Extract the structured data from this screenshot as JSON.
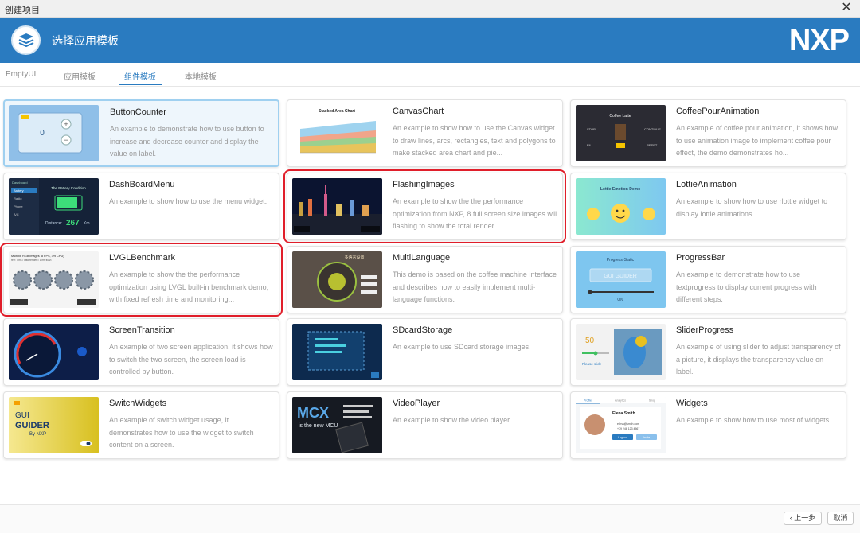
{
  "window": {
    "title": "创建项目",
    "close_glyph": "✕"
  },
  "header": {
    "title": "选择应用模板",
    "brand": "NXP"
  },
  "tabs": [
    {
      "label": "EmptyUI"
    },
    {
      "label": "应用模板"
    },
    {
      "label": "组件模板"
    },
    {
      "label": "本地模板"
    }
  ],
  "active_tab": "组件模板",
  "cards": [
    {
      "name": "ButtonCounter",
      "desc": "An example to demonstrate how to use button to increase and decrease counter and display the value on label.",
      "selected": true
    },
    {
      "name": "CanvasChart",
      "desc": "An example to show how to use the Canvas widget to draw lines, arcs, rectangles, text and polygons to make stacked area chart and pie..."
    },
    {
      "name": "CoffeePourAnimation",
      "desc": "An example of coffee pour animation, it shows how to use animation image to implement coffee pour effect, the demo demonstrates ho..."
    },
    {
      "name": "DashBoardMenu",
      "desc": "An example to show how to use the menu widget."
    },
    {
      "name": "FlashingImages",
      "desc": "An example to show the the performance optimization from NXP, 8 full screen size images will flashing to show the total render...",
      "highlighted": true
    },
    {
      "name": "LottieAnimation",
      "desc": "An example to show how to use rlottie widget to display lottie animations."
    },
    {
      "name": "LVGLBenchmark",
      "desc": "An example to show the the performance optimization using LVGL built-in benchmark demo, with fixed refresh time and monitoring...",
      "highlighted": true
    },
    {
      "name": "MultiLanguage",
      "desc": "This demo is based on the coffee machine interface and describes how to easily implement multi-language functions."
    },
    {
      "name": "ProgressBar",
      "desc": "An example to demonstrate how to use textprogress to display current progress with different steps."
    },
    {
      "name": "ScreenTransition",
      "desc": "An example of two screen application, it shows how to switch the two screen, the screen load is controlled by button."
    },
    {
      "name": "SDcardStorage",
      "desc": "An example to use SDcard storage images."
    },
    {
      "name": "SliderProgress",
      "desc": "An example of using slider to adjust transparency of a picture, it displays the transparency value on label."
    },
    {
      "name": "SwitchWidgets",
      "desc": "An example of switch widget usage, it demonstrates how to use the widget to switch content on a screen."
    },
    {
      "name": "VideoPlayer",
      "desc": "An example to show the video player."
    },
    {
      "name": "Widgets",
      "desc": "An example to show how to use most of widgets."
    }
  ],
  "thumb_text": {
    "button_counter": {
      "value": "0",
      "plus": "+",
      "minus": "−"
    },
    "canvas_chart": {
      "title": "Stacked Area Chart"
    },
    "coffee": {
      "title": "Coffee Latte",
      "stop": "STOP",
      "continue": "CONTINUE",
      "fill": "FILL",
      "reset": "RESET"
    },
    "dashboard": {
      "tab": "Dashboard",
      "items": [
        "Battery",
        "Radio",
        "Phone",
        "A/C"
      ],
      "heading": "The Battery Condition",
      "distance_label": "Distance:",
      "distance_value": "267",
      "unit": "Km"
    },
    "lottie": {
      "title": "Lottie Emotion Demo"
    },
    "lvgl": {
      "title": "Multiple RGB images (8 FPS, 3% CPU)",
      "sub": "refr: 7 ms / ditto render = 1 ms flush"
    },
    "multilang": {
      "title": "多语言设置"
    },
    "progress": {
      "title": "Progress-Static",
      "banner": "GUI GUIDER",
      "percent": "0%"
    },
    "slider": {
      "value": "50",
      "label": "Please slide"
    },
    "switch": {
      "line1": "GUI",
      "line2": "GUIDER",
      "line3": "By NXP"
    },
    "video": {
      "line1": "MCX",
      "line2": "is the new MCU"
    },
    "widgets": {
      "tabs": [
        "Profile",
        "Analytics",
        "Shop"
      ],
      "name": "Elena Smith",
      "email": "elena@smith.com",
      "phone": "+79 246 123 4567",
      "btn1": "Log out",
      "btn2": "Invite"
    }
  },
  "footer": {
    "prev": "上一步",
    "cancel": "取消"
  }
}
